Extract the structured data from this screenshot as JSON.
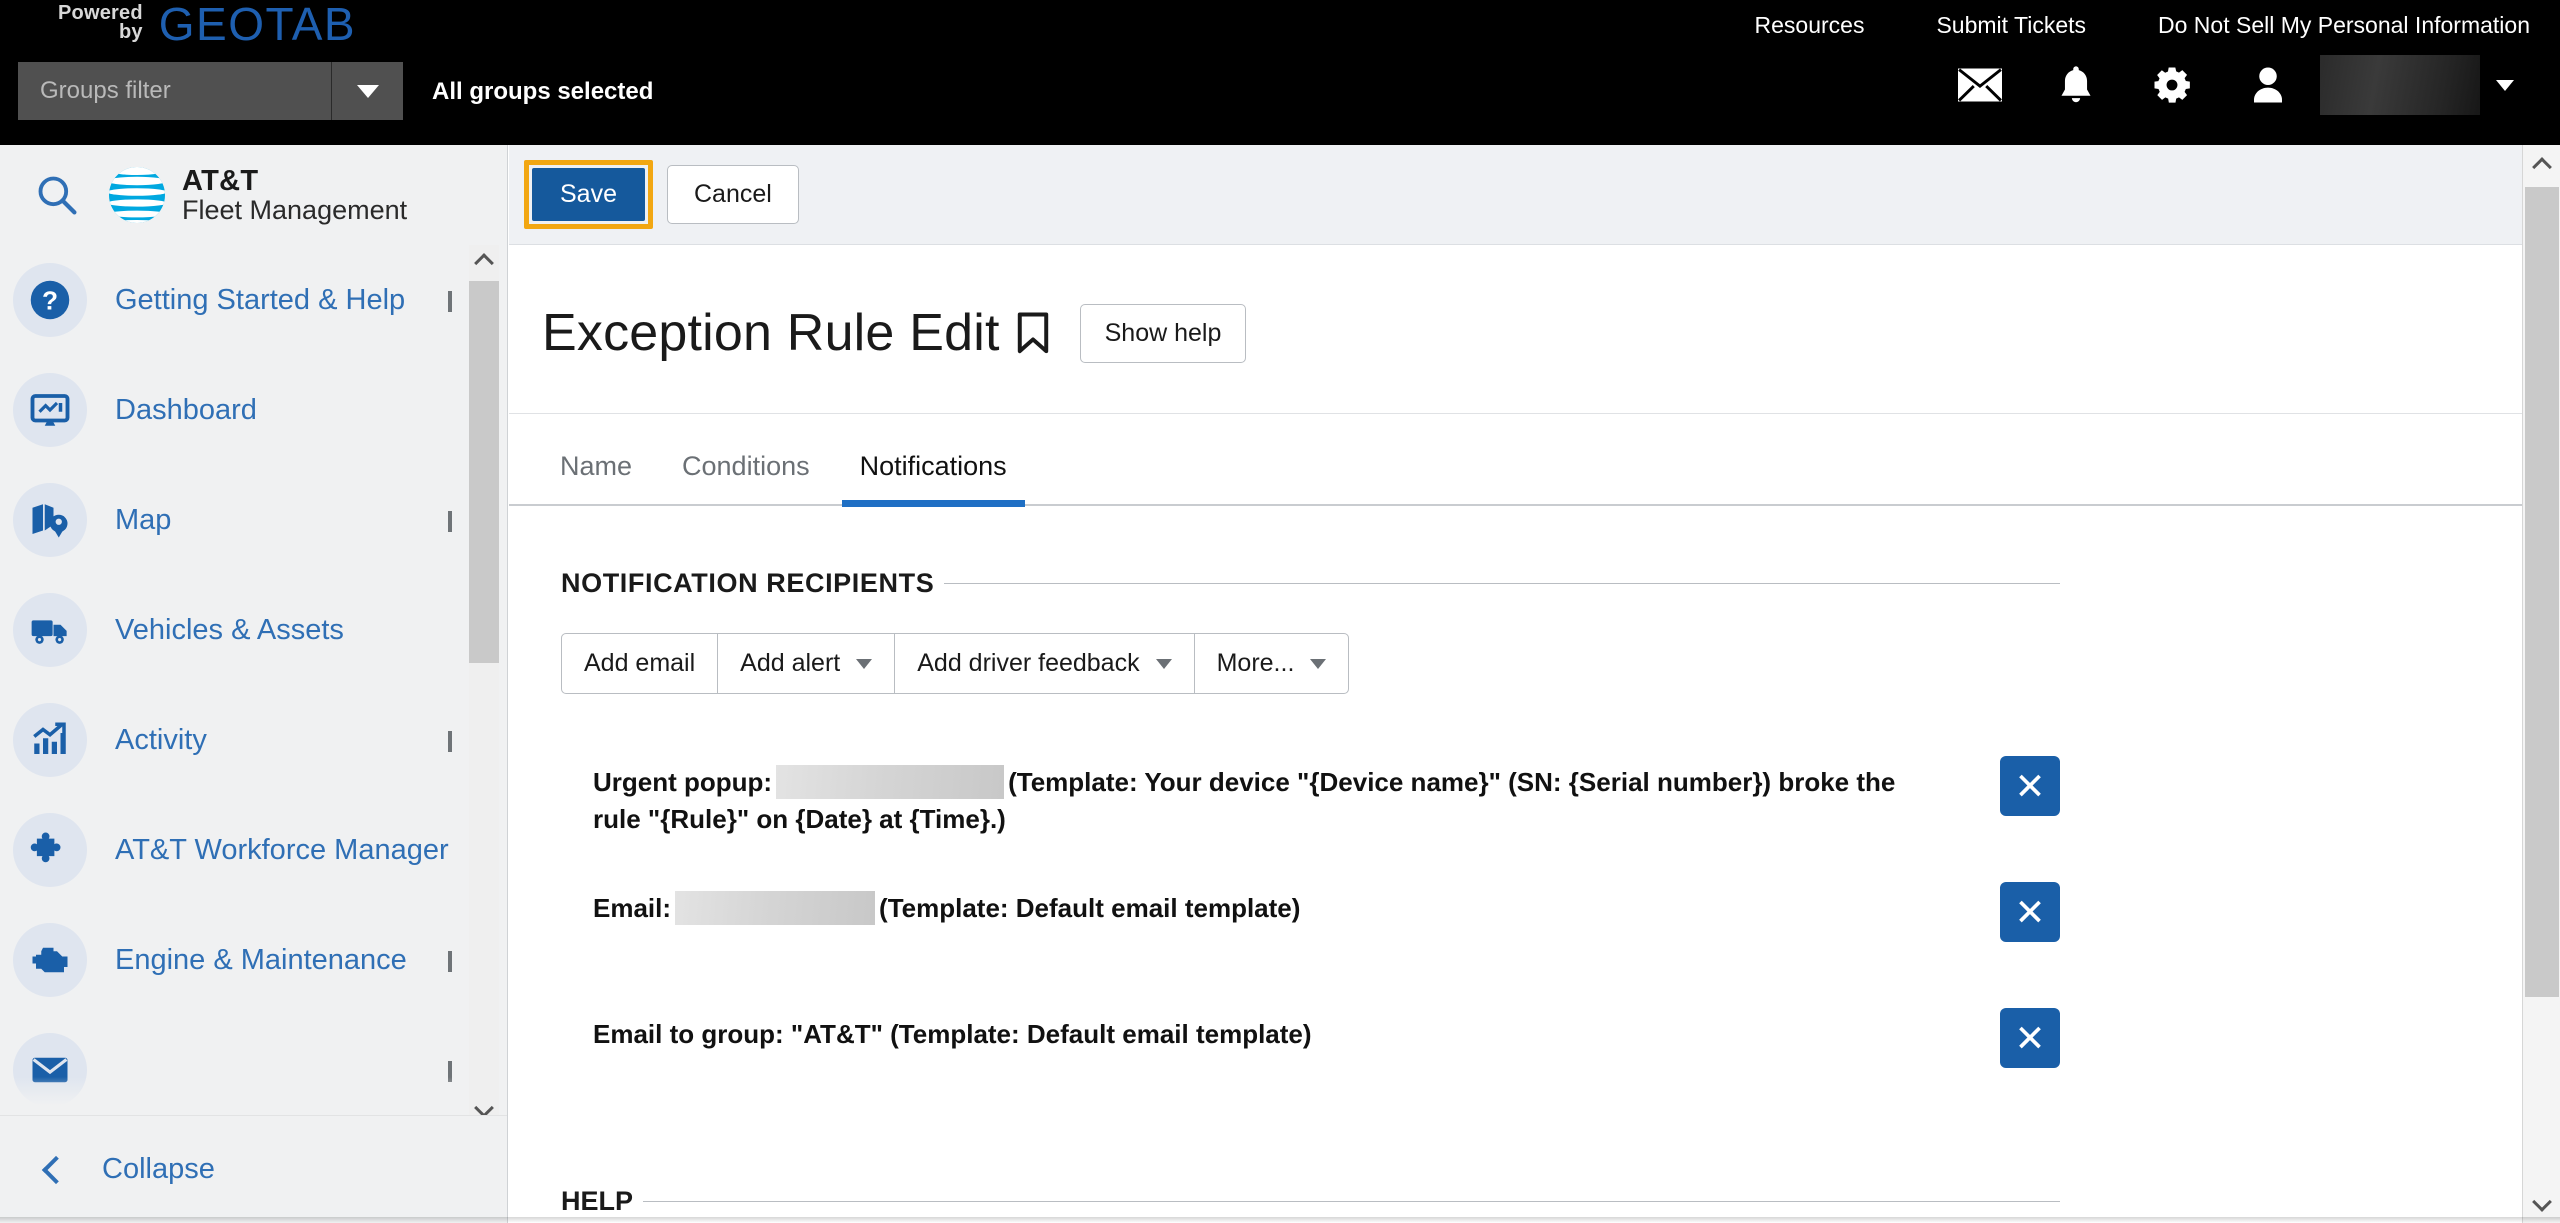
{
  "topbar": {
    "powered_line1": "Powered",
    "powered_line2": "by",
    "brand": "GEOTAB",
    "nav": [
      {
        "label": "Resources"
      },
      {
        "label": "Submit Tickets"
      },
      {
        "label": "Do Not Sell My Personal Information"
      }
    ],
    "groups_filter_placeholder": "Groups filter",
    "groups_status": "All groups selected",
    "icons": [
      {
        "name": "mail-icon"
      },
      {
        "name": "bell-icon"
      },
      {
        "name": "gear-icon"
      },
      {
        "name": "user-icon"
      }
    ],
    "user_name_redacted": ""
  },
  "sidebar": {
    "search_icon": "search-icon",
    "brand_line1": "AT&T",
    "brand_line2": "Fleet Management",
    "items": [
      {
        "label": "Getting Started & Help",
        "icon": "question-circle-icon",
        "expandable": true
      },
      {
        "label": "Dashboard",
        "icon": "dashboard-monitor-icon",
        "expandable": false
      },
      {
        "label": "Map",
        "icon": "map-pin-icon",
        "expandable": true
      },
      {
        "label": "Vehicles & Assets",
        "icon": "truck-icon",
        "expandable": false
      },
      {
        "label": "Activity",
        "icon": "chart-bar-arrow-icon",
        "expandable": true
      },
      {
        "label": "AT&T Workforce Manager",
        "icon": "puzzle-piece-icon",
        "expandable": false
      },
      {
        "label": "Engine & Maintenance",
        "icon": "engine-icon",
        "expandable": true
      },
      {
        "label": "",
        "icon": "envelope-icon",
        "expandable": true
      }
    ],
    "collapse_label": "Collapse"
  },
  "main": {
    "save_label": "Save",
    "cancel_label": "Cancel",
    "page_title": "Exception Rule Edit",
    "bookmark_icon": "bookmark-icon",
    "show_help_label": "Show help",
    "tabs": [
      {
        "label": "Name",
        "active": false
      },
      {
        "label": "Conditions",
        "active": false
      },
      {
        "label": "Notifications",
        "active": true
      }
    ],
    "notification_recipients": {
      "section_label": "NOTIFICATION RECIPIENTS",
      "buttons": [
        {
          "label": "Add email",
          "has_caret": false
        },
        {
          "label": "Add alert",
          "has_caret": true
        },
        {
          "label": "Add driver feedback",
          "has_caret": true
        },
        {
          "label": "More...",
          "has_caret": true
        }
      ],
      "rows": [
        {
          "prefix": "Urgent popup:",
          "redacted": true,
          "suffix": "(Template: Your device \"{Device name}\" (SN: {Serial number}) broke the rule \"{Rule}\" on {Date} at {Time}.)",
          "remove_label": "✕"
        },
        {
          "prefix": "Email:",
          "redacted": true,
          "suffix": "(Template: Default email template)",
          "remove_label": "✕"
        },
        {
          "prefix": "Email to group: \"AT&T\" (Template: Default email template)",
          "redacted": false,
          "suffix": "",
          "remove_label": "✕"
        }
      ]
    },
    "help_section_label": "HELP"
  },
  "colors": {
    "accent_blue": "#1a5fa8",
    "link_blue": "#2f6fb5",
    "focus_orange": "#f2a712",
    "tab_underline": "#1f6fc4",
    "topbar_black": "#000000",
    "geotab_blue": "#1e5fb0"
  }
}
